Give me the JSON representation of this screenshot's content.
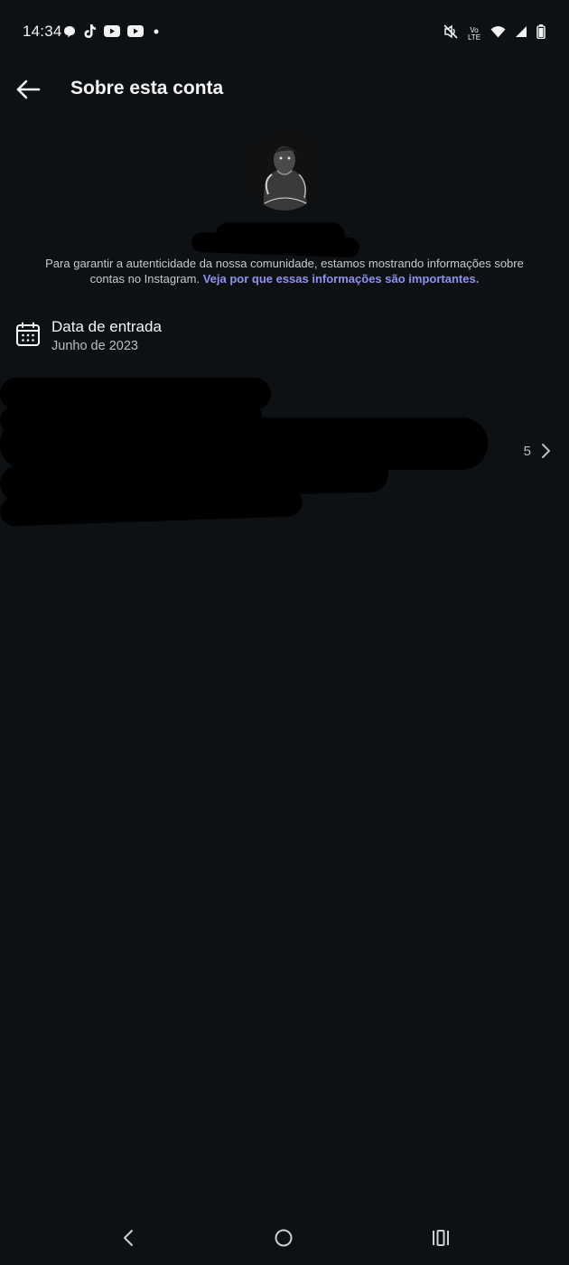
{
  "status_bar": {
    "time": "14:34",
    "left_icons": [
      "threads-icon",
      "tiktok-icon",
      "youtube-icon",
      "youtube-icon",
      "dot-icon"
    ],
    "right_icons": [
      "vibrate-mute-icon",
      "volte-icon",
      "wifi-icon",
      "signal-icon",
      "battery-icon"
    ],
    "volte_label_top": "Vo",
    "volte_label_bottom": "LTE"
  },
  "app_bar": {
    "title": "Sobre esta conta",
    "back_icon": "arrow-left-icon"
  },
  "profile": {
    "avatar_icon": "avatar-photo"
  },
  "info": {
    "text_part1": "Para garantir a autenticidade da nossa comunidade, estamos mostrando informações sobre contas no Instagram. ",
    "link_text": "Veja por que essas informações são importantes."
  },
  "date_joined": {
    "icon": "calendar-icon",
    "label": "Data de entrada",
    "value": "Junho de 2023"
  },
  "hidden_row": {
    "count": "5",
    "chevron_icon": "chevron-right-icon"
  },
  "nav_bar": {
    "back_icon": "nav-back-icon",
    "home_icon": "nav-home-icon",
    "recents_icon": "nav-recents-icon"
  },
  "colors": {
    "background": "#0e1114",
    "link": "#8d93f2",
    "text": "#f5f5f5",
    "secondary_text": "#bdbdbd"
  }
}
